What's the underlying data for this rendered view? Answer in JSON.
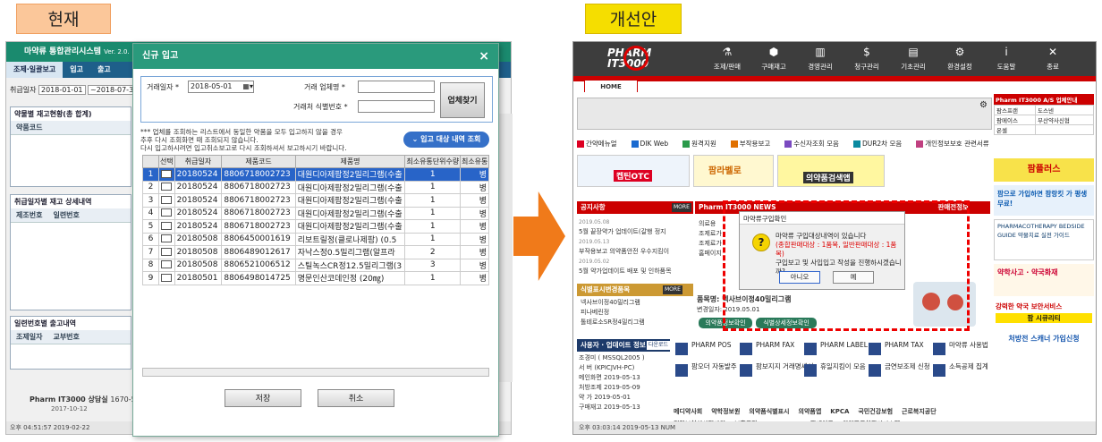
{
  "labels": {
    "current": "현재",
    "improved": "개선안"
  },
  "left_app": {
    "title": "마약류 통합관리시스템",
    "version": "Ver. 2.0.",
    "menu": [
      "조제·일괄보고",
      "입고",
      "출고"
    ],
    "date_label": "취급일자",
    "date_from": "2018-01-01",
    "date_to": "~2018-07-31",
    "panel1": "약물별 재고현황(총 합계)",
    "panel1_col": "약품코드",
    "panel2": "취급일자별 재고 상세내역",
    "panel2_cols": [
      "제조번호",
      "일련번호"
    ],
    "panel3": "일련번호별 출고내역",
    "panel3_cols": [
      "조제일자",
      "교부번호"
    ],
    "footer": "Pharm IT3000 상담실",
    "footer_phone": "1670-58",
    "footer_sub": "2017-10-12",
    "status": "오후 04:51:57  2019-02-22"
  },
  "dialog": {
    "title": "신규 입고",
    "close": "×",
    "trade_date_label": "거래일자 *",
    "trade_date": "2018-05-01",
    "company_label": "거래 업체명 *",
    "id_label": "거래처 식별번호 *",
    "find_button": "업체찾기",
    "note": "*** 업체를 조회하는 리스트에서 동일한 약품을 모두 입고하지 않을 경우\n추후 다시 조회화면 때 조회되지 않습니다.\n다시 입고하시려면 입고취소보고로 다시 조회하셔서 보고하시기 바랍니다.",
    "list_button": "입고 대상 내역 조회",
    "columns": [
      "선택",
      "취급일자",
      "제품코드",
      "제품명",
      "최소유통단위수량",
      "최소유통"
    ],
    "rows": [
      {
        "n": "1",
        "date": "20180524",
        "code": "8806718002723",
        "name": "대원디아제팜정2밀리그램(수출",
        "qty": "1",
        "unit": "병"
      },
      {
        "n": "2",
        "date": "20180524",
        "code": "8806718002723",
        "name": "대원디아제팜정2밀리그램(수출",
        "qty": "1",
        "unit": "병"
      },
      {
        "n": "3",
        "date": "20180524",
        "code": "8806718002723",
        "name": "대원디아제팜정2밀리그램(수출",
        "qty": "1",
        "unit": "병"
      },
      {
        "n": "4",
        "date": "20180524",
        "code": "8806718002723",
        "name": "대원디아제팜정2밀리그램(수출",
        "qty": "1",
        "unit": "병"
      },
      {
        "n": "5",
        "date": "20180524",
        "code": "8806718002723",
        "name": "대원디아제팜정2밀리그램(수출",
        "qty": "1",
        "unit": "병"
      },
      {
        "n": "6",
        "date": "20180508",
        "code": "8806450001619",
        "name": "리보트릴정(클로나제팜) (0.5",
        "qty": "1",
        "unit": "병"
      },
      {
        "n": "7",
        "date": "20180508",
        "code": "8806489012617",
        "name": "자낙스정0.5밀리그램(알프라",
        "qty": "2",
        "unit": "병"
      },
      {
        "n": "8",
        "date": "20180508",
        "code": "8806521006512",
        "name": "스틸녹스CR정12.5밀리그램(3",
        "qty": "3",
        "unit": "병"
      },
      {
        "n": "9",
        "date": "20180501",
        "code": "8806498014725",
        "name": "명문인산코데인정 (20㎎)",
        "qty": "1",
        "unit": "병"
      }
    ],
    "save": "저장",
    "cancel": "취소"
  },
  "right_app": {
    "logo_top": "PHARM",
    "logo_bottom": "IT3000",
    "menu": [
      {
        "icon": "⚗",
        "label": "조제/판매"
      },
      {
        "icon": "⬢",
        "label": "구매재고"
      },
      {
        "icon": "▥",
        "label": "경영관리"
      },
      {
        "icon": "$",
        "label": "청구관리"
      },
      {
        "icon": "▤",
        "label": "기초관리"
      },
      {
        "icon": "⚙",
        "label": "환경설정"
      },
      {
        "icon": "i",
        "label": "도움말"
      },
      {
        "icon": "✕",
        "label": "종료"
      }
    ],
    "home_tab": "HOME",
    "links": [
      "간약메뉴얼",
      "DIK Web",
      "원격지원",
      "부작용보고",
      "수신자조회 모음",
      "DUR2차 모음",
      "개인정보보호 관련서류"
    ],
    "ad1": "켑틴OTC",
    "ad2": "팜라벨로",
    "ad3": "의약품검색앱",
    "notice_title": "공지사항",
    "notices": [
      {
        "date": "2019.05.08",
        "text": "5월 끝장약가 업데이트(갈행 정지"
      },
      {
        "date": "2019.05.13",
        "text": "부작용보고 의약품안전 우수지킴이"
      },
      {
        "date": "2019.05.02",
        "text": "5월 약가업데이트 배포 및 인하품목"
      }
    ],
    "news_title": "Pharm IT3000 NEWS",
    "notice_right": "판매전정보",
    "news_items": [
      "의료용",
      "조제료가",
      "조제료가",
      "홈페이지"
    ],
    "drug_title": "식별표시변경품목",
    "drugs": [
      "넥사브이정40밀리그램",
      "피나베린정",
      "톨테로소SR정4밀리그램"
    ],
    "product_label": "품목명:",
    "product_name": "넥사브이정40밀리그램",
    "product_sub": "변경일자: 2019.05.01",
    "btn_info": "의약품정보확인",
    "btn_detail": "식별상세정보확인",
    "user_title": "사용자 · 업데이트 정보",
    "user_badge": "다운로드",
    "user_rows": [
      "조경미 ( MSSQL2005 )",
      "서   버 (KPICJVH-PC)",
      "메인화면 2019-05-13",
      "처방조제 2019-05-09",
      "약   가 2019-05-01",
      "구매재고 2019-05-13"
    ],
    "services": [
      "PHARM POS",
      "PHARM FAX",
      "PHARM LABEL",
      "PHARM TAX",
      "마약류 사용법",
      "팜오더 자동발주",
      "팜보지지 거래명세서",
      "휴일지킴이 모음",
      "금연보조제 신청",
      "소득공제 집계"
    ],
    "partners": [
      "메디약사회",
      "약학정보원",
      "의약품식별표시",
      "의약품앱",
      "KPCA",
      "국민건강보험",
      "근로복지공단",
      "건강보험심사평가원",
      "보훈공단",
      "HMPMALL",
      "팜페이몰",
      "의약품통합관리시스템"
    ],
    "side_title": "Pharm IT3000 A/S 업체안내",
    "side_rows": [
      [
        "팜스프랜",
        "도스넨"
      ],
      [
        "팜메이스",
        "부산약사신협"
      ],
      [
        "온셀",
        ""
      ]
    ],
    "side_ads": [
      "팜플러스",
      "팜으로 가입하면 팜랑킷 가 평생무료!",
      "PHARMACOTHERAPY BEDSIDE GUIDE 약물치료 실전 가이드",
      "약학사고 · 약국화재",
      "강력한 약국 보안서비스",
      "팜 시큐리티",
      "처방전 스캐너 가입신청"
    ],
    "status": "오후 03:03:14  2019-05-13   NUM"
  },
  "popup": {
    "title": "마약류구입확인",
    "line1": "마약류 구입대상내역이 있습니다",
    "line2": "(종합판매대상 : 1품목, 일반판매대상 : 1품목)",
    "line3": "구입보고 및 사입입고 작성을 진행하시겠습니까?",
    "no": "아니오",
    "yes": "예"
  }
}
